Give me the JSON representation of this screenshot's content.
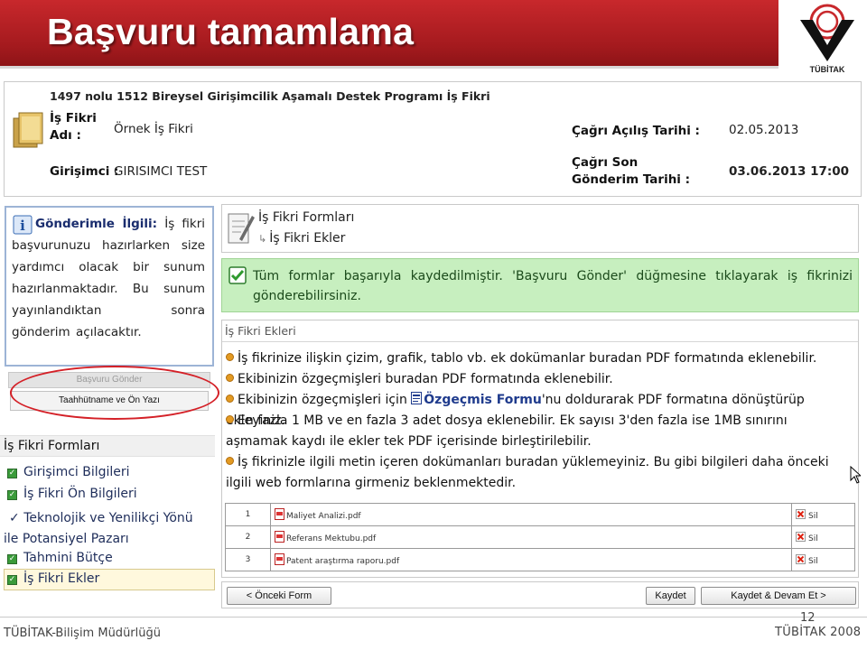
{
  "banner": {
    "title": "Başvuru tamamlama",
    "logo_text": "TÜBİTAK"
  },
  "info": {
    "program": "1497 nolu 1512 Bireysel Girişimcilik Aşamalı Destek Programı İş Fikri",
    "idea_name_label": "İş Fikri Adı :",
    "idea_name_value": "Örnek İş Fikri",
    "entrepreneur_label": "Girişimci :",
    "entrepreneur_value": "GIRISIMCI TEST",
    "call_open_label": "Çağrı Açılış Tarihi :",
    "call_open_value": "02.05.2013",
    "call_deadline_label": "Çağrı Son Gönderim Tarihi :",
    "call_deadline_value": "03.06.2013 17:00"
  },
  "notice": {
    "heading": "Gönderimle İlgili:",
    "text": "İş fikri başvurunuzu hazırlarken size yardımcı olacak bir sunum hazırlanmaktadır. Bu sunum yayınlandıktan sonra gönderim açılacaktır."
  },
  "sidebar_buttons": {
    "send": "Başvuru Gönder",
    "commitment": "Taahhütname ve Ön Yazı"
  },
  "forms": {
    "heading": "İş Fikri Formları",
    "items": [
      {
        "label": "Girişimci Bilgileri"
      },
      {
        "label": "İş Fikri Ön Bilgileri"
      },
      {
        "label": "Teknolojik ve Yenilikçi Yönü ile Potansiyel Pazarı"
      },
      {
        "label": "Tahmini Bütçe"
      },
      {
        "label": "İş Fikri Ekler"
      }
    ]
  },
  "breadcrumb": {
    "level1": "İş Fikri Formları",
    "level2": "İş Fikri Ekler"
  },
  "success_message": "Tüm formlar başarıyla kaydedilmiştir. 'Başvuru Gönder' düğmesine tıklayarak iş fikrinizi gönderebilirsiniz.",
  "attachments": {
    "heading": "İş Fikri Ekleri",
    "bullets": [
      "İş fikrinize ilişkin çizim, grafik, tablo vb. ek dokümanlar buradan PDF formatında eklenebilir.",
      "Ekibinizin özgeçmişleri buradan PDF formatında eklenebilir.",
      "Ekibinizin özgeçmişleri için",
      "Özgeçmis Formu",
      "'nu doldurarak PDF formatına dönüştürüp ekleyiniz.",
      "En fazla 1 MB ve en fazla 3 adet dosya eklenebilir. Ek sayısı 3'den fazla ise 1MB sınırını aşmamak kaydı ile ekler tek PDF içerisinde birleştirilebilir.",
      "İş fikrinizle ilgili metin içeren dokümanları buradan yüklemeyiniz. Bu gibi bilgileri daha önceki ilgili web formlarına girmeniz beklenmektedir."
    ],
    "files": [
      {
        "no": "1",
        "name": "Maliyet Analizi.pdf",
        "action": "Sil"
      },
      {
        "no": "2",
        "name": "Referans Mektubu.pdf",
        "action": "Sil"
      },
      {
        "no": "3",
        "name": "Patent araştırma raporu.pdf",
        "action": "Sil"
      }
    ]
  },
  "actions": {
    "prev": "< Önceki Form",
    "save": "Kaydet",
    "save_continue": "Kaydet & Devam Et >"
  },
  "footer": {
    "left": "TÜBİTAK-Bilişim Müdürlüğü",
    "right": "TÜBİTAK 2008",
    "page": "12"
  },
  "colors": {
    "banner_red": "#b8222a",
    "success_bg": "#c7efbf",
    "link_blue": "#1f3b8d",
    "ellipse_red": "#d42027"
  }
}
